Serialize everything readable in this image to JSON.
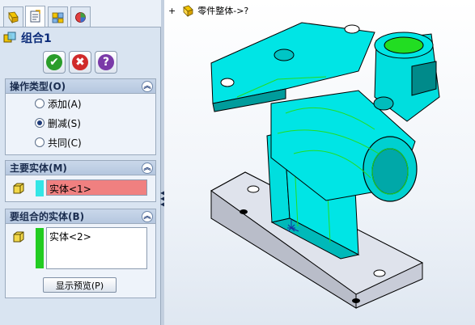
{
  "feature": {
    "title": "组合1"
  },
  "tabs": [
    {
      "name": "feature-manager"
    },
    {
      "name": "property-manager"
    },
    {
      "name": "configuration-manager"
    },
    {
      "name": "display-manager"
    }
  ],
  "operation": {
    "header": "操作类型(O)",
    "options": [
      {
        "label": "添加(A)",
        "selected": false
      },
      {
        "label": "删减(S)",
        "selected": true
      },
      {
        "label": "共同(C)",
        "selected": false
      }
    ]
  },
  "main_body": {
    "header": "主要实体(M)",
    "value": "实体<1>",
    "swatch_color": "#33e6e6"
  },
  "combine_bodies": {
    "header": "要组合的实体(B)",
    "value": "实体<2>",
    "swatch_color": "#22cc22",
    "preview_button": "显示预览(P)"
  },
  "viewport": {
    "tree_label": "零件整体->?"
  },
  "colors": {
    "panel_bg": "#d9e4f1",
    "title_text": "#0a2a78",
    "body_cyan": "#00e5e5",
    "body_green": "#22dd22",
    "base_gray": "#dfe3ec",
    "selection_highlight": "#f08080"
  }
}
